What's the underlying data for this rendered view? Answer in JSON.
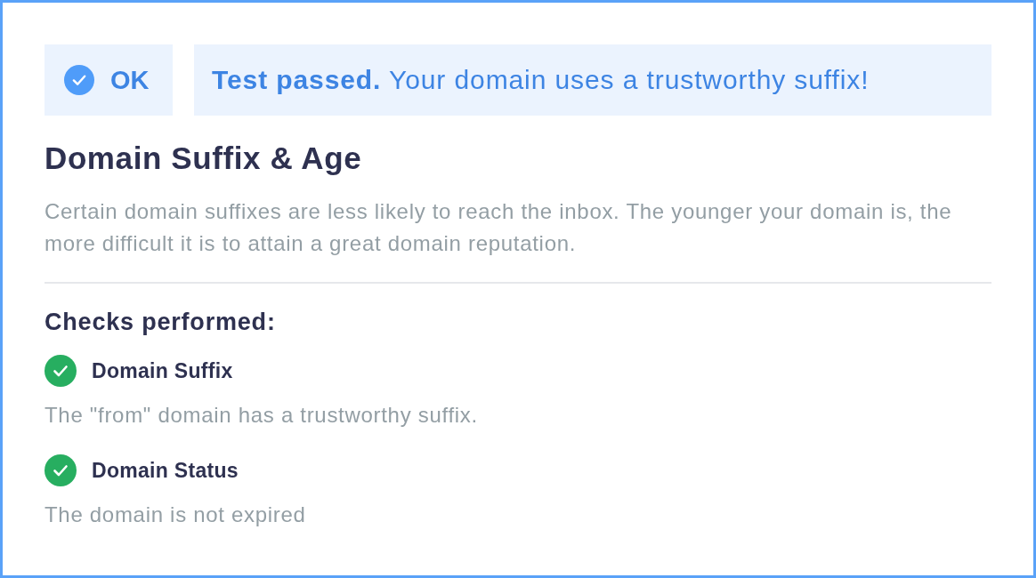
{
  "status": {
    "label": "OK",
    "passed": true
  },
  "banner": {
    "text": "**Test passed.** Your domain uses a trustworthy suffix!",
    "passed": true
  },
  "section": {
    "title": "Domain Suffix & Age",
    "description": "Certain domain suffixes are less likely to reach the inbox. The younger your domain is, the more difficult it is to attain a great domain reputation."
  },
  "checks_heading": "Checks performed:",
  "checks": [
    {
      "title": "Domain Suffix",
      "description": "The \"from\" domain has a trustworthy suffix.",
      "passed": true
    },
    {
      "title": "Domain Status",
      "description": "The domain is not expired",
      "passed": true
    }
  ]
}
